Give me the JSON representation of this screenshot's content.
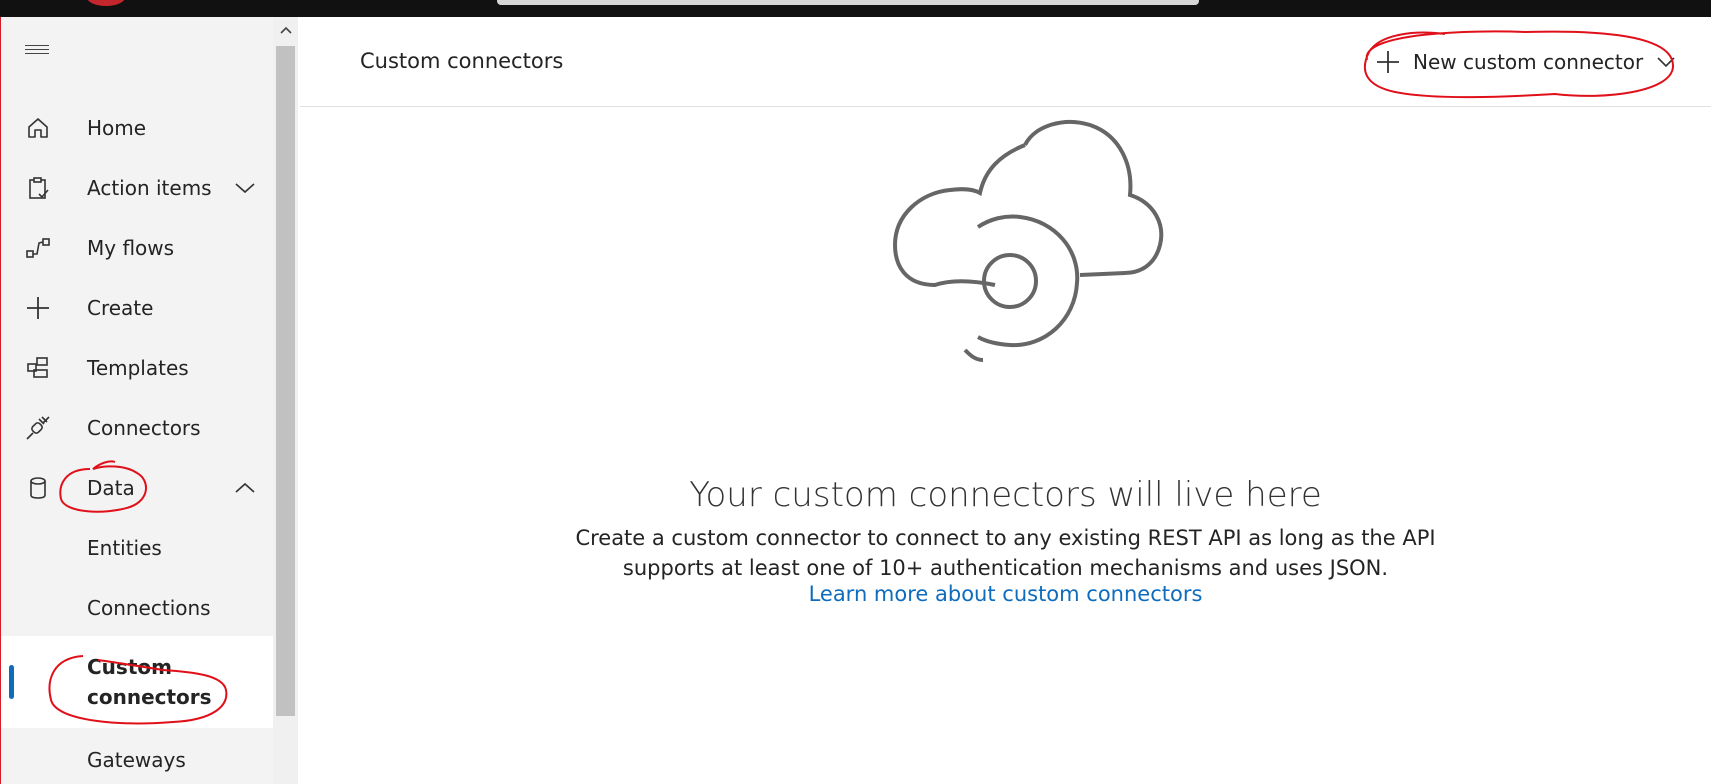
{
  "sidebar": {
    "items": [
      {
        "label": "Home",
        "icon": "home-icon"
      },
      {
        "label": "Action items",
        "icon": "clipboard-check-icon",
        "chevron": "down"
      },
      {
        "label": "My flows",
        "icon": "flow-icon"
      },
      {
        "label": "Create",
        "icon": "plus-icon"
      },
      {
        "label": "Templates",
        "icon": "templates-icon"
      },
      {
        "label": "Connectors",
        "icon": "plug-icon"
      },
      {
        "label": "Data",
        "icon": "database-icon",
        "chevron": "up"
      },
      {
        "label": "Entities"
      },
      {
        "label": "Connections"
      },
      {
        "label": "Custom connectors",
        "selected": true
      },
      {
        "label": "Gateways"
      }
    ]
  },
  "header": {
    "title": "Custom connectors",
    "new_button": "New custom connector"
  },
  "empty_state": {
    "title": "Your custom connectors will live here",
    "description_line1": "Create a custom connector to connect to any existing REST API as long as the API",
    "description_line2": "supports at least one of 10+ authentication mechanisms and uses JSON.",
    "link": "Learn more about custom connectors"
  },
  "colors": {
    "accent": "#0f6cbd",
    "annotation": "#e0101a",
    "sidebar_bg": "#f3f3f3"
  }
}
